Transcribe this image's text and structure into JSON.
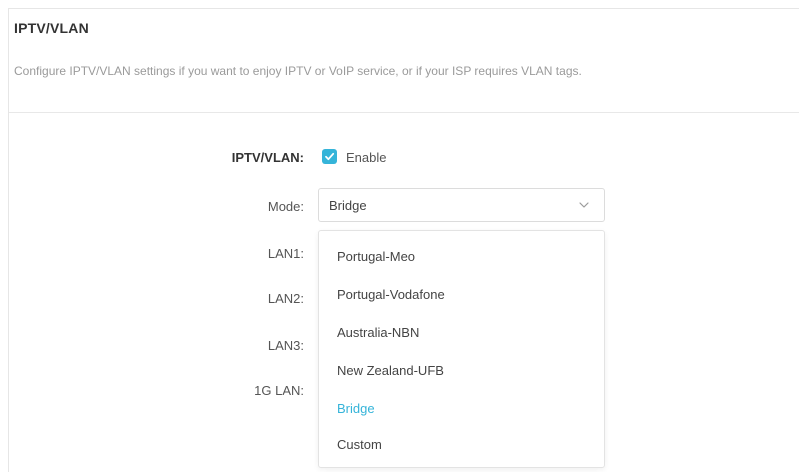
{
  "section": {
    "title": "IPTV/VLAN",
    "description": "Configure IPTV/VLAN settings if you want to enjoy IPTV or VoIP service, or if your ISP requires VLAN tags."
  },
  "form": {
    "iptv_label": "IPTV/VLAN:",
    "enable_label": "Enable",
    "enable_checked": true,
    "mode_label": "Mode:",
    "mode_value": "Bridge",
    "lan1_label": "LAN1:",
    "lan2_label": "LAN2:",
    "lan3_label": "LAN3:",
    "lan_1g_label": "1G LAN:"
  },
  "dropdown": {
    "options": [
      "Portugal-Meo",
      "Portugal-Vodafone",
      "Australia-NBN",
      "New Zealand-UFB",
      "Bridge",
      "Custom"
    ],
    "selected_index": 4
  },
  "colors": {
    "accent": "#35b4d9"
  }
}
